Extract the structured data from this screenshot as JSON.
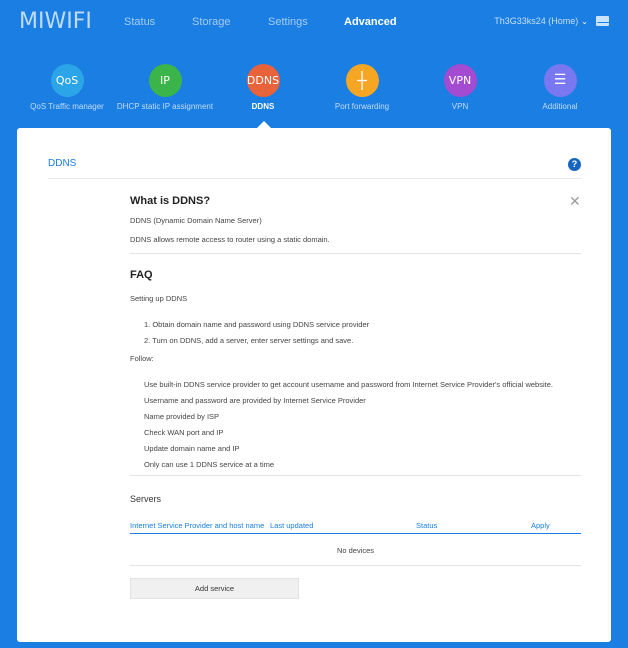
{
  "brand": {
    "logo": "MIWIFI"
  },
  "nav": [
    {
      "label": "Status"
    },
    {
      "label": "Storage"
    },
    {
      "label": "Settings"
    },
    {
      "label": "Advanced",
      "active": true
    }
  ],
  "user": {
    "name": "Th3G33ks24 (Home)",
    "chevron": "⌄"
  },
  "apps": [
    {
      "icon_text": "QoS",
      "label": "QoS Traffic manager",
      "color": "#2ba5e8"
    },
    {
      "icon_text": "IP",
      "label": "DHCP static IP assignment",
      "color": "#3bb54a"
    },
    {
      "icon_text": "DDNS",
      "label": "DDNS",
      "color": "#e8623a",
      "active": true
    },
    {
      "icon_text": "┼",
      "label": "Port forwarding",
      "color": "#f6a623"
    },
    {
      "icon_text": "VPN",
      "label": "VPN",
      "color": "#a34bd1"
    },
    {
      "icon_text": "☰",
      "label": "Additional",
      "color": "#7a78f0"
    }
  ],
  "panel": {
    "title": "DDNS",
    "help": "?",
    "close": "✕",
    "what": {
      "heading": "What is DDNS?",
      "line1": "DDNS (Dynamic Domain Name Server)",
      "line2": "DDNS allows remote access to router using a static domain."
    },
    "faq": {
      "heading": "FAQ",
      "intro": "Setting up DDNS",
      "step1": "1. Obtain domain name and password using DDNS service provider",
      "step2": "2. Turn on DDNS, add a server, enter server settings and save.",
      "follow": "Follow:",
      "notes": [
        "Use built-in DDNS service provider to get account username and password from Internet Service Provider's official website.",
        "Username and password are provided by Internet Service Provider",
        "Name provided by ISP",
        "Check WAN port and IP",
        "Update domain name and IP",
        "Only can use 1 DDNS service at a time"
      ]
    },
    "servers": {
      "heading": "Servers",
      "columns": [
        "Internet Service Provider and host name",
        "Last updated",
        "Status",
        "Apply"
      ],
      "empty": "No devices",
      "add_button": "Add service"
    }
  }
}
